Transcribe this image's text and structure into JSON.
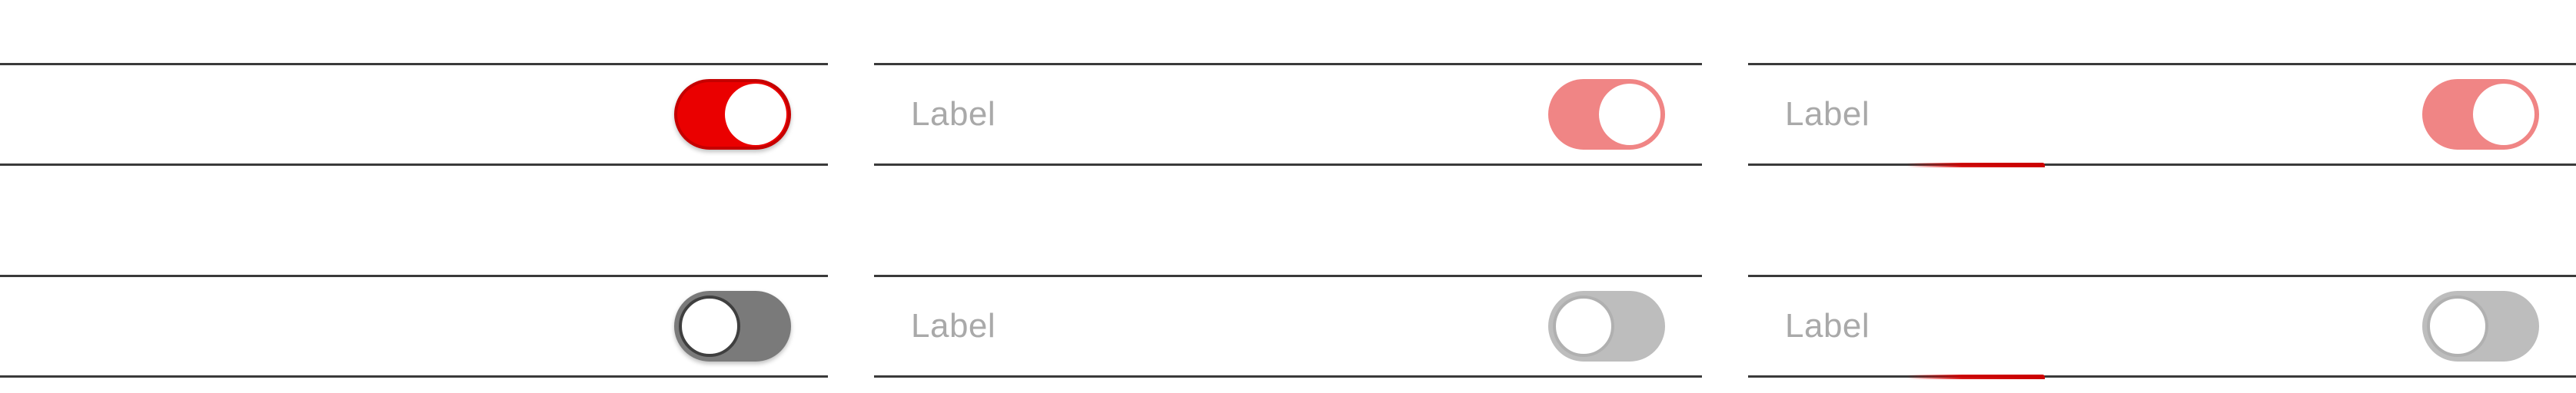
{
  "colors": {
    "on_active": "#ea0000",
    "on_active_border": "#c50000",
    "on_disabled": "#f08585",
    "off_active": "#7a7a7a",
    "off_active_border": "#3f3f3f",
    "off_disabled": "#bdbdbd",
    "error_accent": "#cc0000"
  },
  "rows": [
    {
      "state": "on",
      "cells": [
        {
          "label": "",
          "variant": "active",
          "checked": true
        },
        {
          "label": "Label",
          "variant": "disabled",
          "checked": true
        },
        {
          "label": "Label",
          "variant": "disabled-error",
          "checked": true
        }
      ]
    },
    {
      "state": "off",
      "cells": [
        {
          "label": "",
          "variant": "active",
          "checked": false
        },
        {
          "label": "Label",
          "variant": "disabled",
          "checked": false
        },
        {
          "label": "Label",
          "variant": "disabled-error",
          "checked": false
        }
      ]
    }
  ]
}
